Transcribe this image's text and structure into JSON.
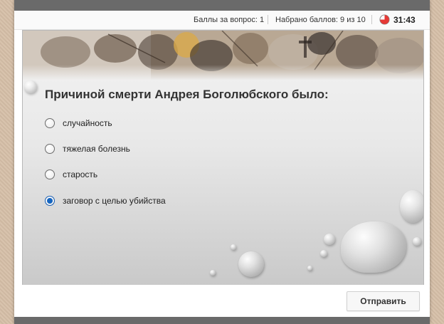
{
  "header": {
    "points_per_question": "Баллы за вопрос: 1",
    "points_scored": "Набрано баллов: 9 из 10",
    "timer": "31:43",
    "timer_icon": "clock-icon",
    "timer_color": "#e53935"
  },
  "question": {
    "text": "Причиной смерти Андрея Боголюбского было:",
    "options": [
      {
        "label": "случайность",
        "selected": false
      },
      {
        "label": "тяжелая болезнь",
        "selected": false
      },
      {
        "label": "старость",
        "selected": false
      },
      {
        "label": "заговор с целью убийства",
        "selected": true
      }
    ]
  },
  "footer": {
    "submit_label": "Отправить"
  },
  "colors": {
    "accent": "#1565c0",
    "chrome": "#6a6a6a"
  }
}
